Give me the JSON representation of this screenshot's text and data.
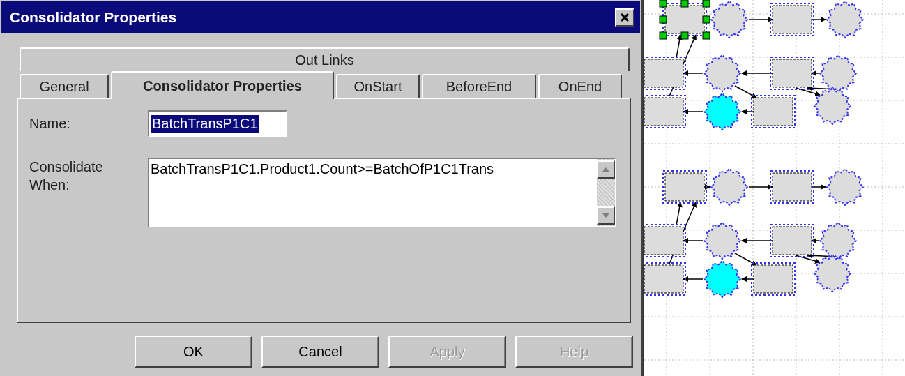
{
  "window": {
    "title": "Consolidator Properties"
  },
  "tab_rows": [
    [
      {
        "label": "Out Links",
        "selected": false
      }
    ],
    [
      {
        "label": "General",
        "selected": false
      },
      {
        "label": "Consolidator Properties",
        "selected": true
      },
      {
        "label": "OnStart",
        "selected": false
      },
      {
        "label": "BeforeEnd",
        "selected": false
      },
      {
        "label": "OnEnd",
        "selected": false
      }
    ]
  ],
  "name_field": {
    "label": "Name:",
    "value": "BatchTransP1C1",
    "text_selected": true
  },
  "condition_field": {
    "label": "Consolidate When:",
    "value": "BatchTransP1C1.Product1.Count>=BatchOfP1C1Trans"
  },
  "buttons": [
    {
      "label": "OK",
      "disabled": false
    },
    {
      "label": "Cancel",
      "disabled": false
    },
    {
      "label": "Apply",
      "disabled": true
    },
    {
      "label": "Help",
      "disabled": true
    }
  ],
  "diagram": {
    "groups": [
      {
        "rows": [
          [
            {
              "kind": "process",
              "selected": true,
              "highlighted": false
            },
            {
              "kind": "event",
              "selected": false,
              "highlighted": false
            },
            {
              "kind": "process",
              "selected": false,
              "highlighted": false
            },
            {
              "kind": "event",
              "selected": false,
              "highlighted": false
            }
          ],
          [
            {
              "kind": "process",
              "selected": false,
              "highlighted": false
            },
            {
              "kind": "event",
              "selected": false,
              "highlighted": false
            },
            {
              "kind": "process",
              "selected": false,
              "highlighted": false
            },
            {
              "kind": "event",
              "selected": false,
              "highlighted": false
            }
          ],
          [
            {
              "kind": "process",
              "selected": false,
              "highlighted": false
            },
            {
              "kind": "event",
              "selected": false,
              "highlighted": true
            },
            {
              "kind": "process",
              "selected": false,
              "highlighted": false
            },
            {
              "kind": "event",
              "selected": false,
              "highlighted": false
            }
          ]
        ]
      },
      {
        "rows": [
          [
            {
              "kind": "process",
              "selected": false,
              "highlighted": false
            },
            {
              "kind": "event",
              "selected": false,
              "highlighted": false
            },
            {
              "kind": "process",
              "selected": false,
              "highlighted": false
            },
            {
              "kind": "event",
              "selected": false,
              "highlighted": false
            }
          ],
          [
            {
              "kind": "process",
              "selected": false,
              "highlighted": false
            },
            {
              "kind": "event",
              "selected": false,
              "highlighted": false
            },
            {
              "kind": "process",
              "selected": false,
              "highlighted": false
            },
            {
              "kind": "event",
              "selected": false,
              "highlighted": false
            }
          ],
          [
            {
              "kind": "process",
              "selected": false,
              "highlighted": false
            },
            {
              "kind": "event",
              "selected": false,
              "highlighted": true
            },
            {
              "kind": "process",
              "selected": false,
              "highlighted": false
            },
            {
              "kind": "event",
              "selected": false,
              "highlighted": false
            }
          ]
        ]
      }
    ]
  }
}
